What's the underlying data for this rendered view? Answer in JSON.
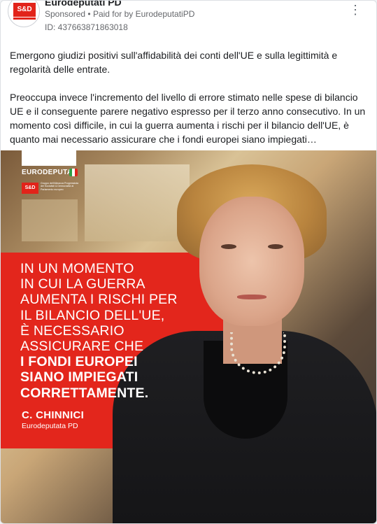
{
  "colors": {
    "accent_red": "#e3261c",
    "text_primary": "#1c1e21",
    "text_secondary": "#65676b"
  },
  "header": {
    "page_name": "Eurodeputati PD",
    "avatar_text": "S&D",
    "sponsored_label": "Sponsored",
    "separator": "•",
    "paid_for_by_label": "Paid for by",
    "advertiser": "EurodeputatiPD",
    "ad_id": "ID: 437663871863018",
    "more_icon": "more-horizontal-icon",
    "more_glyph": "⋮"
  },
  "post": {
    "paragraphs": [
      "Emergono giudizi positivi sull'affidabilità dei conti dell'UE e sulla legittimità e regolarità delle entrate.",
      "Preoccupa invece l'incremento del livello di errore stimato nelle spese di bilancio UE e il conseguente parere negativo espresso per il terzo anno consecutivo. In un momento così difficile, in cui la guerra aumenta i rischi per il bilancio dell'UE, è quanto mai necessario assicurare che i fondi europei siano impiegati…"
    ]
  },
  "creative": {
    "brand": "EURODEPUTATI",
    "sd_logo": "S&D",
    "sd_group_text": "Gruppo dell'Alleanza Progressista dei Socialisti & Democratici al Parlamento europeo",
    "quote_lines": [
      "IN UN MOMENTO",
      "IN CUI LA GUERRA",
      "AUMENTA I RISCHI PER",
      "IL BILANCIO DELL'UE,",
      "È NECESSARIO",
      "ASSICURARE CHE",
      "I FONDI EUROPEI",
      "SIANO IMPIEGATI",
      "CORRETTAMENTE."
    ],
    "signature_name": "C. CHINNICI",
    "signature_role": "Eurodeputata PD"
  }
}
